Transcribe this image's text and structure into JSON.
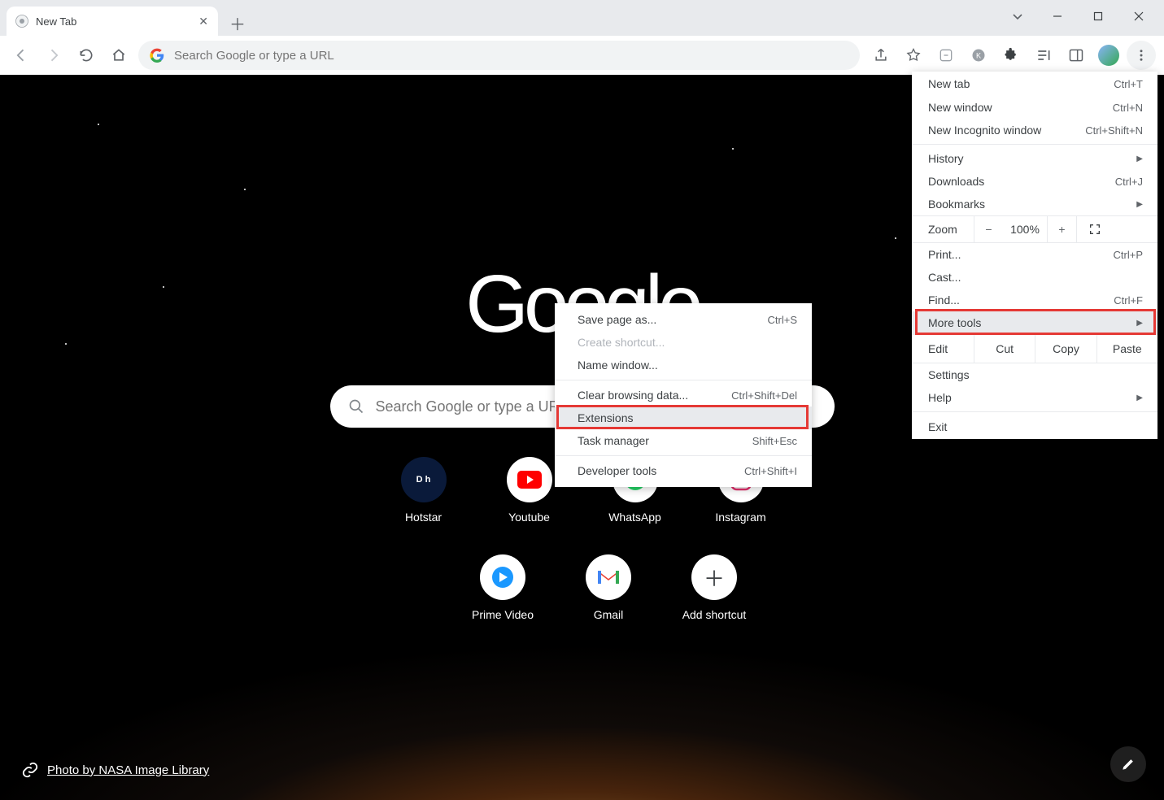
{
  "tab": {
    "title": "New Tab"
  },
  "omnibox": {
    "placeholder": "Search Google or type a URL"
  },
  "page": {
    "logo": "Google",
    "search_placeholder": "Search Google or type a URL",
    "shortcuts_row1": [
      {
        "label": "Hotstar"
      },
      {
        "label": "Youtube"
      },
      {
        "label": "WhatsApp"
      },
      {
        "label": "Instagram"
      }
    ],
    "shortcuts_row2": [
      {
        "label": "Prime Video"
      },
      {
        "label": "Gmail"
      },
      {
        "label": "Add shortcut"
      }
    ],
    "attribution": "Photo by NASA Image Library"
  },
  "menu": {
    "new_tab": {
      "label": "New tab",
      "shortcut": "Ctrl+T"
    },
    "new_window": {
      "label": "New window",
      "shortcut": "Ctrl+N"
    },
    "new_incognito": {
      "label": "New Incognito window",
      "shortcut": "Ctrl+Shift+N"
    },
    "history": {
      "label": "History"
    },
    "downloads": {
      "label": "Downloads",
      "shortcut": "Ctrl+J"
    },
    "bookmarks": {
      "label": "Bookmarks"
    },
    "zoom": {
      "label": "Zoom",
      "value": "100%",
      "minus": "−",
      "plus": "+"
    },
    "print": {
      "label": "Print...",
      "shortcut": "Ctrl+P"
    },
    "cast": {
      "label": "Cast..."
    },
    "find": {
      "label": "Find...",
      "shortcut": "Ctrl+F"
    },
    "more_tools": {
      "label": "More tools"
    },
    "edit": {
      "label": "Edit",
      "cut": "Cut",
      "copy": "Copy",
      "paste": "Paste"
    },
    "settings": {
      "label": "Settings"
    },
    "help": {
      "label": "Help"
    },
    "exit": {
      "label": "Exit"
    }
  },
  "submenu": {
    "save_page": {
      "label": "Save page as...",
      "shortcut": "Ctrl+S"
    },
    "create_shortcut": {
      "label": "Create shortcut..."
    },
    "name_window": {
      "label": "Name window..."
    },
    "clear_browsing": {
      "label": "Clear browsing data...",
      "shortcut": "Ctrl+Shift+Del"
    },
    "extensions": {
      "label": "Extensions"
    },
    "task_manager": {
      "label": "Task manager",
      "shortcut": "Shift+Esc"
    },
    "developer_tools": {
      "label": "Developer tools",
      "shortcut": "Ctrl+Shift+I"
    }
  }
}
